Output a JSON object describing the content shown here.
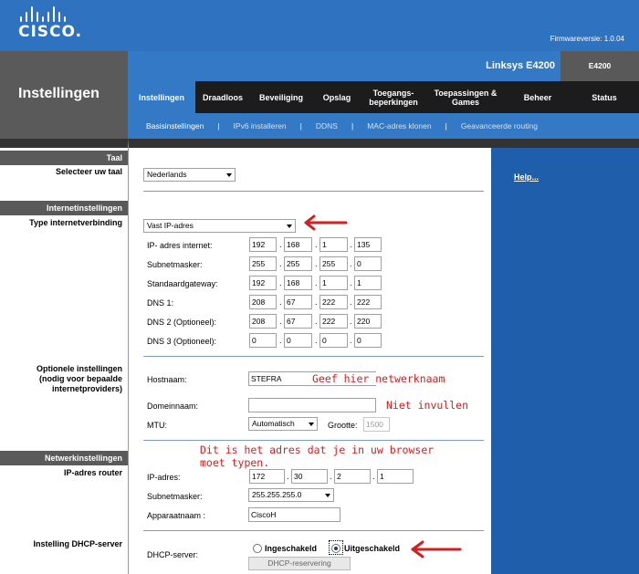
{
  "header": {
    "logo_text": "CISCO.",
    "firmware": "Firmwareversie: 1.0.04",
    "product_name": "Linksys E4200",
    "model": "E4200",
    "page_title": "Instellingen"
  },
  "main_nav": [
    "Instellingen",
    "Draadloos",
    "Beveiliging",
    "Opslag",
    "Toegangs-\nbeperkingen",
    "Toepassingen &\nGames",
    "Beheer",
    "Status"
  ],
  "sub_nav": [
    "Basisinstellingen",
    "IPv6 installeren",
    "DDNS",
    "MAC-adres klonen",
    "Geavanceerde routing"
  ],
  "left": {
    "taal_head": "Taal",
    "taal_label": "Selecteer uw taal",
    "internet_head": "Internetinstellingen",
    "internet_label": "Type internetverbinding",
    "optional_label": "Optionele instellingen\n(nodig voor bepaalde\ninternetproviders)",
    "network_head": "Netwerkinstellingen",
    "router_label": "IP-adres router",
    "dhcp_label": "Instelling DHCP-server"
  },
  "language": {
    "selected": "Nederlands"
  },
  "connection": {
    "type": "Vast IP-adres"
  },
  "static_ip": {
    "ip_label": "IP- adres internet:",
    "ip": [
      "192",
      "168",
      "1",
      "135"
    ],
    "subnet_label": "Subnetmasker:",
    "subnet": [
      "255",
      "255",
      "255",
      "0"
    ],
    "gateway_label": "Standaardgateway:",
    "gateway": [
      "192",
      "168",
      "1",
      "1"
    ],
    "dns1_label": "DNS 1:",
    "dns1": [
      "208",
      "67",
      "222",
      "222"
    ],
    "dns2_label": "DNS 2 (Optioneel):",
    "dns2": [
      "208",
      "67",
      "222",
      "220"
    ],
    "dns3_label": "DNS 3 (Optioneel):",
    "dns3": [
      "0",
      "0",
      "0",
      "0"
    ]
  },
  "optional": {
    "hostname_label": "Hostnaam:",
    "hostname_value": "STEFRA",
    "domain_label": "Domeinnaam:",
    "domain_value": "",
    "mtu_label": "MTU:",
    "mtu_value": "Automatisch",
    "size_label": "Grootte:",
    "size_value": "1500"
  },
  "router": {
    "ip_label": "IP-adres:",
    "ip": [
      "172",
      "30",
      "2",
      "1"
    ],
    "subnet_label": "Subnetmasker:",
    "subnet_value": "255.255.255.0",
    "device_label": "Apparaatnaam :",
    "device_value": "CiscoH"
  },
  "dhcp": {
    "label": "DHCP-server:",
    "enabled_label": "Ingeschakeld",
    "disabled_label": "Uitgeschakeld",
    "selected": "Uitgeschakeld",
    "reservation_button": "DHCP-reservering"
  },
  "help": {
    "link": "Help..."
  },
  "annotations": {
    "hostname_note": "Geef hier netwerknaam",
    "domain_note": "Niet invullen",
    "browser_note": "Dit is het adres dat je in uw browser\nmoet typen."
  },
  "colors": {
    "header_blue": "#2f72c0",
    "nav_blue": "#3379c5",
    "help_blue": "#1f5eab",
    "annotation_red": "#d02020"
  }
}
